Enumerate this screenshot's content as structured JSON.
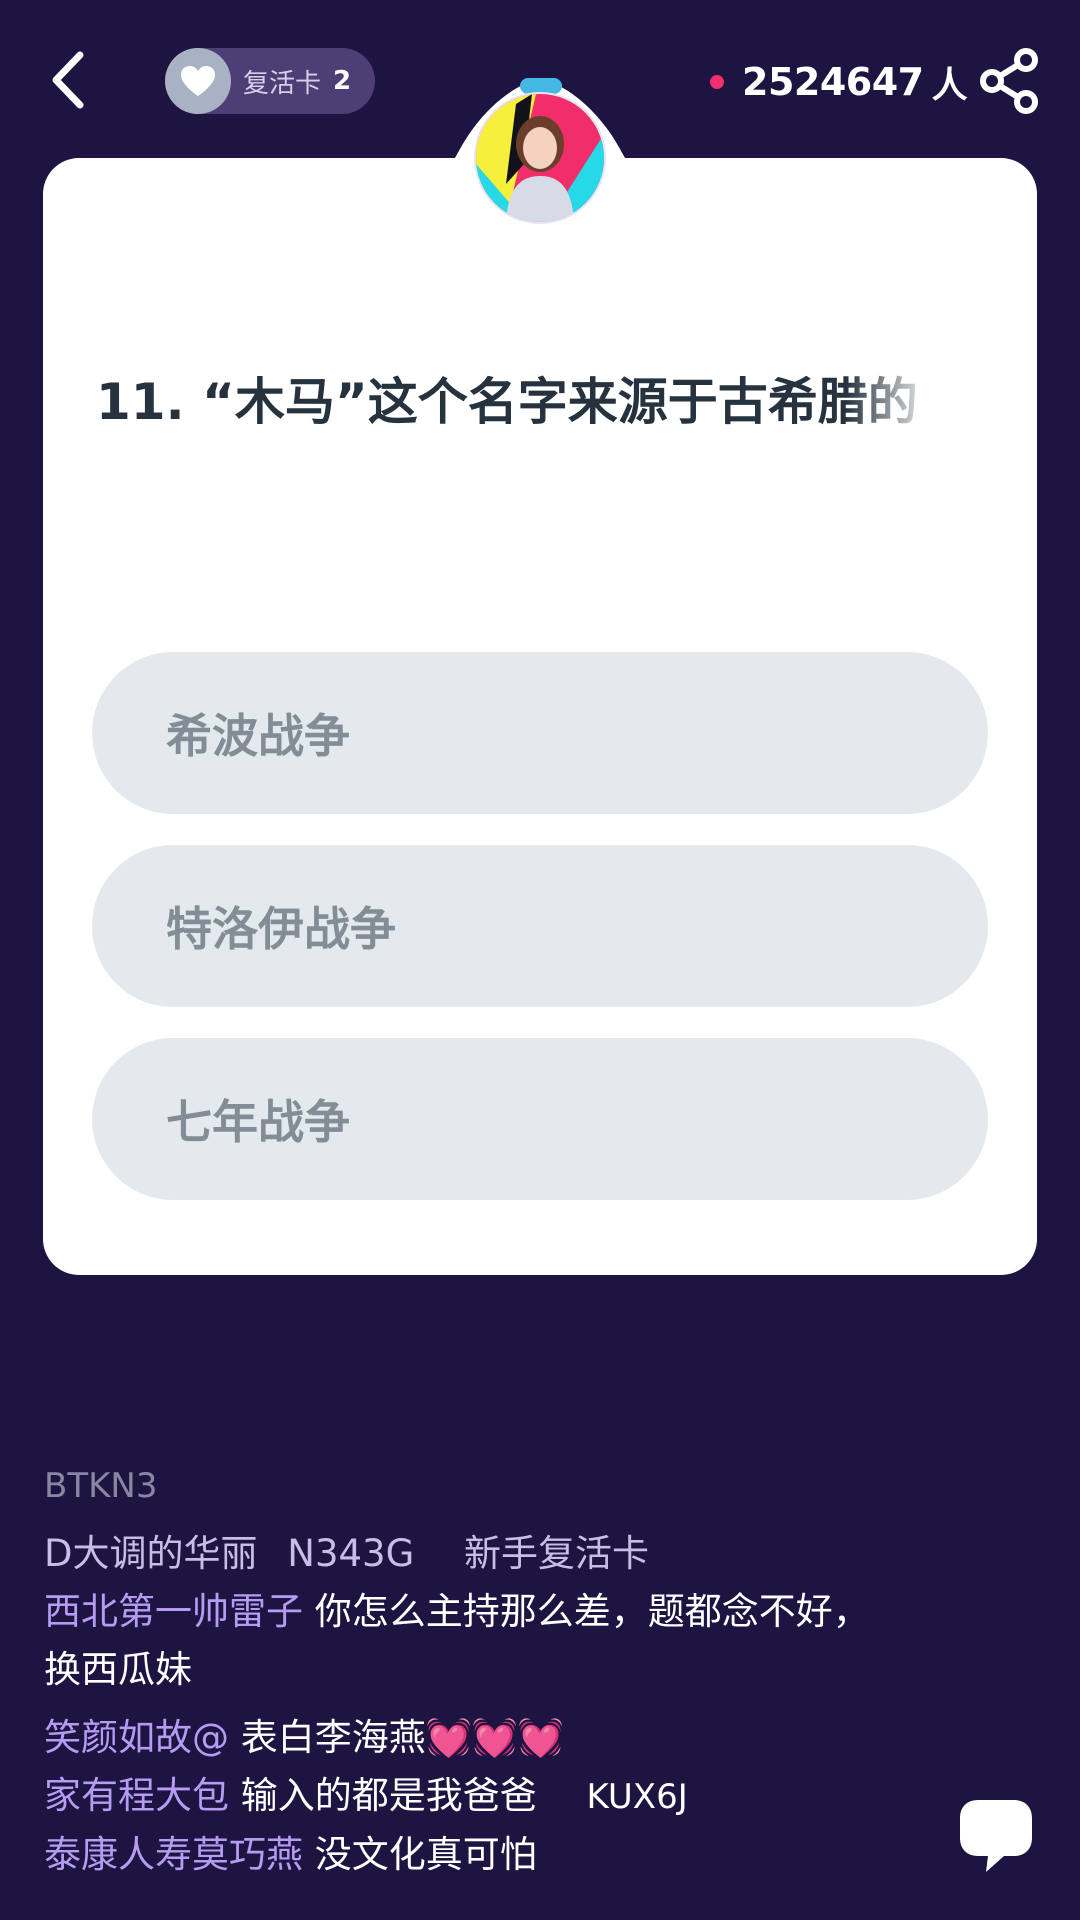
{
  "header": {
    "revive_label": "复活卡",
    "revive_count": "2",
    "online_count": "2524647",
    "online_unit": "人"
  },
  "card": {
    "question": "11. “木马”这个名字来源于古希腊的",
    "options": [
      {
        "label": "希波战争"
      },
      {
        "label": "特洛伊战争"
      },
      {
        "label": "七年战争"
      }
    ]
  },
  "comments": [
    {
      "user": "BTKN3",
      "text": ""
    },
    {
      "user": "D大调的华丽",
      "code": "N343G",
      "text": "新手复活卡"
    },
    {
      "user": "西北第一帅雷子",
      "text": "你怎么主持那么差，题都念不好，",
      "text2": "换西瓜妹"
    },
    {
      "user": "笑颜如故@",
      "text": "表白李海燕💓💓💓"
    },
    {
      "user": "家有程大包",
      "text": "输入的都是我爸爸",
      "code": "KUX6J"
    },
    {
      "user": "泰康人寿莫巧燕",
      "text": "没文化真可怕"
    }
  ],
  "colors": {
    "background": "#1d1442",
    "card": "#ffffff",
    "option_bg": "#e4e9ee",
    "option_text": "#838d97",
    "username": "#b59cf2",
    "online_dot": "#f0306a"
  },
  "icons": {
    "back": "chevron-left-icon",
    "revive": "heart-icon",
    "share": "share-icon",
    "chat": "chat-bubble-icon"
  }
}
